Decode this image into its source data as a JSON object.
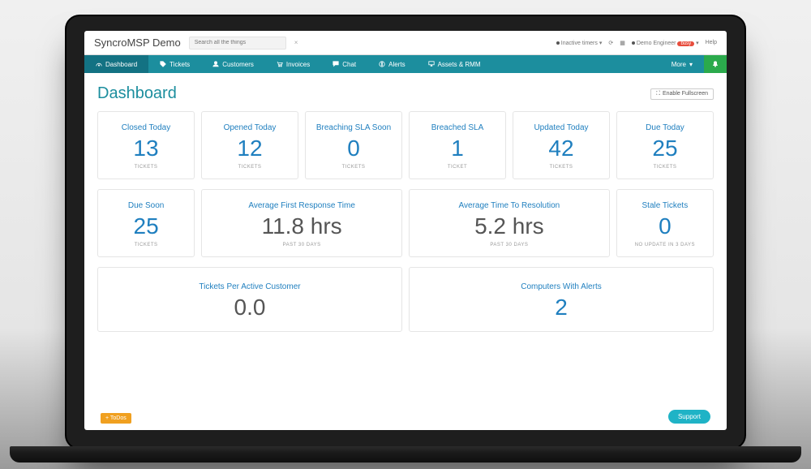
{
  "header": {
    "brand": "SyncroMSP Demo",
    "search_placeholder": "Search all the things",
    "inactive_label": "Inactive timers",
    "user_label": "Demo Engineer",
    "user_badge": "busy",
    "help_label": "Help"
  },
  "nav": {
    "dashboard": "Dashboard",
    "tickets": "Tickets",
    "customers": "Customers",
    "invoices": "Invoices",
    "chat": "Chat",
    "alerts": "Alerts",
    "assets": "Assets & RMM",
    "more": "More"
  },
  "page": {
    "title": "Dashboard",
    "fullscreen": "Enable Fullscreen"
  },
  "cards_row1": [
    {
      "title": "Closed Today",
      "value": "13",
      "sub": "TICKETS"
    },
    {
      "title": "Opened Today",
      "value": "12",
      "sub": "TICKETS"
    },
    {
      "title": "Breaching SLA Soon",
      "value": "0",
      "sub": "TICKETS"
    },
    {
      "title": "Breached SLA",
      "value": "1",
      "sub": "TICKET"
    },
    {
      "title": "Updated Today",
      "value": "42",
      "sub": "TICKETS"
    },
    {
      "title": "Due Today",
      "value": "25",
      "sub": "TICKETS"
    }
  ],
  "cards_row2": [
    {
      "title": "Due Soon",
      "value": "25",
      "sub": "TICKETS",
      "style": "small"
    },
    {
      "title": "Average First Response Time",
      "value": "11.8 hrs",
      "sub": "PAST 30 DAYS",
      "style": "wide dark"
    },
    {
      "title": "Average Time To Resolution",
      "value": "5.2 hrs",
      "sub": "PAST 30 DAYS",
      "style": "wide dark"
    },
    {
      "title": "Stale Tickets",
      "value": "0",
      "sub": "NO UPDATE IN 3 DAYS",
      "style": "small"
    }
  ],
  "cards_row3": [
    {
      "title": "Tickets Per Active Customer",
      "value": "0.0",
      "style": "dark"
    },
    {
      "title": "Computers With Alerts",
      "value": "2",
      "style": ""
    }
  ],
  "footer": {
    "todos": "+ ToDos",
    "support": "Support"
  }
}
